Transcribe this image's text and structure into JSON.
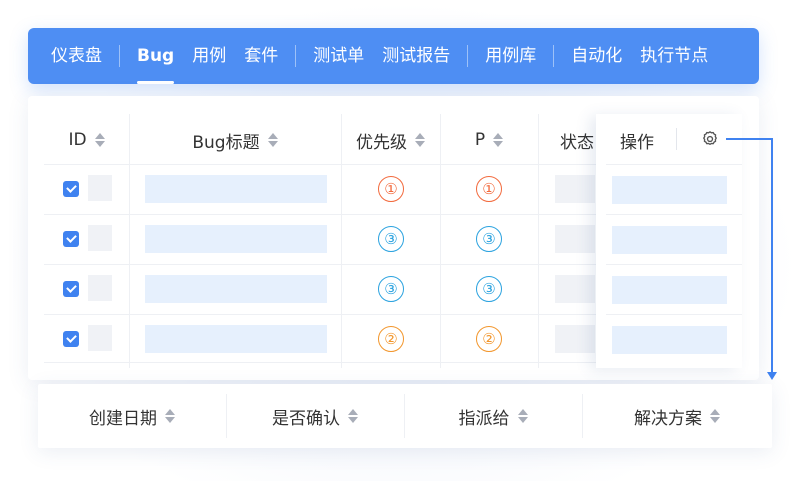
{
  "nav": {
    "items": [
      {
        "label": "仪表盘"
      },
      {
        "label": "Bug"
      },
      {
        "label": "用例"
      },
      {
        "label": "套件"
      },
      {
        "label": "测试单"
      },
      {
        "label": "测试报告"
      },
      {
        "label": "用例库"
      },
      {
        "label": "自动化"
      },
      {
        "label": "执行节点"
      }
    ],
    "active": "Bug"
  },
  "table": {
    "columns": {
      "id": "ID",
      "title": "Bug标题",
      "priority": "优先级",
      "p": "P",
      "status": "状态",
      "ops": "操作"
    },
    "rows": [
      {
        "checked": true,
        "priority": "①",
        "p": "①",
        "level": "high"
      },
      {
        "checked": true,
        "priority": "③",
        "p": "③",
        "level": "low"
      },
      {
        "checked": true,
        "priority": "③",
        "p": "③",
        "level": "low"
      },
      {
        "checked": true,
        "priority": "②",
        "p": "②",
        "level": "mid"
      }
    ]
  },
  "extra_columns": [
    {
      "label": "创建日期"
    },
    {
      "label": "是否确认"
    },
    {
      "label": "指派给"
    },
    {
      "label": "解决方案"
    }
  ],
  "icons": {
    "settings": "gear-icon",
    "sort": "sort-icon"
  },
  "colors": {
    "accent": "#4e8ef3",
    "high": "#f26a3d",
    "mid": "#f2962c",
    "low": "#2aa2df"
  }
}
